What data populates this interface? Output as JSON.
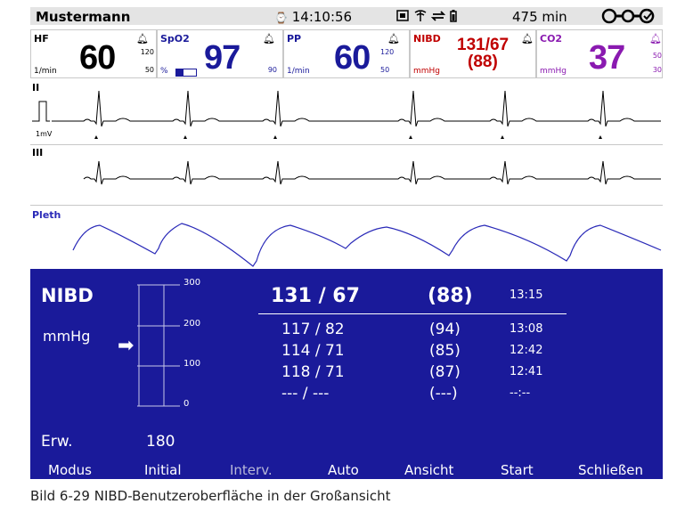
{
  "header": {
    "patient_name": "Mustermann",
    "time": "14:10:56",
    "icons": "⇌ ⌁",
    "battery_remaining": "475 min",
    "icon_names": [
      "clock-icon",
      "network-icon",
      "antenna-icon",
      "sync-icon",
      "battery-icon",
      "connector-icon"
    ]
  },
  "params": {
    "hf": {
      "label": "HF",
      "value": "60",
      "unit": "1/min",
      "limit_high": "120",
      "limit_low": "50"
    },
    "spo2": {
      "label": "SpO2",
      "value": "97",
      "unit": "%",
      "limit_low": "90",
      "perfusion_fill": 0.35
    },
    "pp": {
      "label": "PP",
      "value": "60",
      "unit": "1/min",
      "limit_high": "120",
      "limit_low": "50"
    },
    "nibd": {
      "label": "NIBD",
      "value": "131/67",
      "mean": "(88)",
      "unit": "mmHg"
    },
    "co2": {
      "label": "CO2",
      "value": "37",
      "unit": "mmHg",
      "limit_high": "50",
      "limit_low": "30"
    }
  },
  "waves": {
    "ecg1_label": "II",
    "calibration_label": "1mV",
    "ecg2_label": "III",
    "pleth_label": "Pleth"
  },
  "nibd_panel": {
    "title": "NIBD",
    "unit": "mmHg",
    "scale": [
      "300",
      "200",
      "100",
      "0"
    ],
    "current": {
      "sys_dia": "131 / 67",
      "mean": "(88)",
      "time": "13:15"
    },
    "history": [
      {
        "sys_dia": "117 / 82",
        "mean": "(94)",
        "time": "13:08"
      },
      {
        "sys_dia": "114 / 71",
        "mean": "(85)",
        "time": "12:42"
      },
      {
        "sys_dia": "118 / 71",
        "mean": "(87)",
        "time": "12:41"
      },
      {
        "sys_dia": "--- / ---",
        "mean": "(---)",
        "time": "--:--"
      }
    ],
    "erw_label": "Erw.",
    "erw_value": "180"
  },
  "softkeys": [
    "Modus",
    "Initial",
    "Interv.",
    "Auto",
    "Ansicht",
    "Start",
    "Schließen"
  ],
  "caption": "Bild 6-29    NIBD-Benutzeroberfläche in der Großansicht",
  "colors": {
    "panel_blue": "#1a1a9a",
    "nibd_red": "#c00000",
    "co2_purple": "#8a1ab0",
    "wave_blue": "#2a2ab8",
    "disabled_key": "#b8b8d8"
  }
}
